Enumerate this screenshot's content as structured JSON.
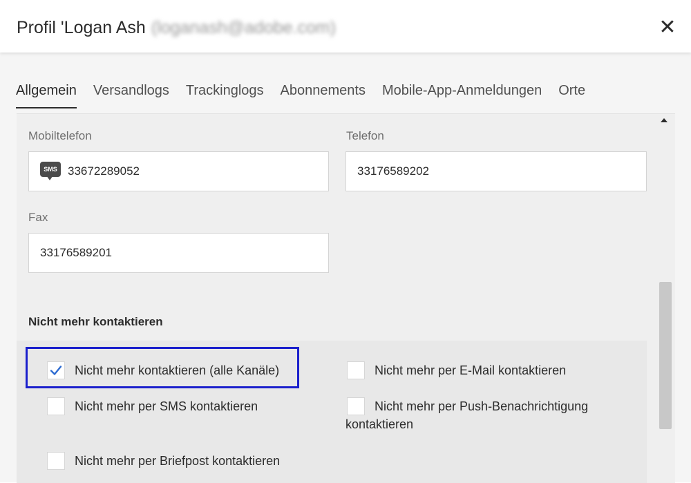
{
  "header": {
    "title": "Profil 'Logan Ash",
    "title_blurred": "(loganash@adobe.com)",
    "close_glyph": "✕"
  },
  "tabs": [
    {
      "label": "Allgemein",
      "active": true
    },
    {
      "label": "Versandlogs",
      "active": false
    },
    {
      "label": "Trackinglogs",
      "active": false
    },
    {
      "label": "Abonnements",
      "active": false
    },
    {
      "label": "Mobile-App-Anmeldungen",
      "active": false
    },
    {
      "label": "Orte",
      "active": false
    }
  ],
  "fields": {
    "mobile": {
      "label": "Mobiltelefon",
      "value": "33672289052",
      "icon": "sms-icon",
      "icon_text": "SMS"
    },
    "phone": {
      "label": "Telefon",
      "value": "33176589202"
    },
    "fax": {
      "label": "Fax",
      "value": "33176589201"
    }
  },
  "no_contact": {
    "title": "Nicht mehr kontaktieren",
    "options": [
      {
        "label": "Nicht mehr kontaktieren (alle Kanäle)",
        "checked": true
      },
      {
        "label": "Nicht mehr per E-Mail kontaktieren",
        "checked": false
      },
      {
        "label": "Nicht mehr per SMS kontaktieren",
        "checked": false
      },
      {
        "label": "Nicht mehr per Push-Benachrichtigung",
        "label_line2": "kontaktieren",
        "checked": false
      },
      {
        "label": "Nicht mehr per Briefpost kontaktieren",
        "checked": false
      }
    ]
  },
  "colors": {
    "focus": "#1a1fcc",
    "check": "#2d6bd1"
  }
}
